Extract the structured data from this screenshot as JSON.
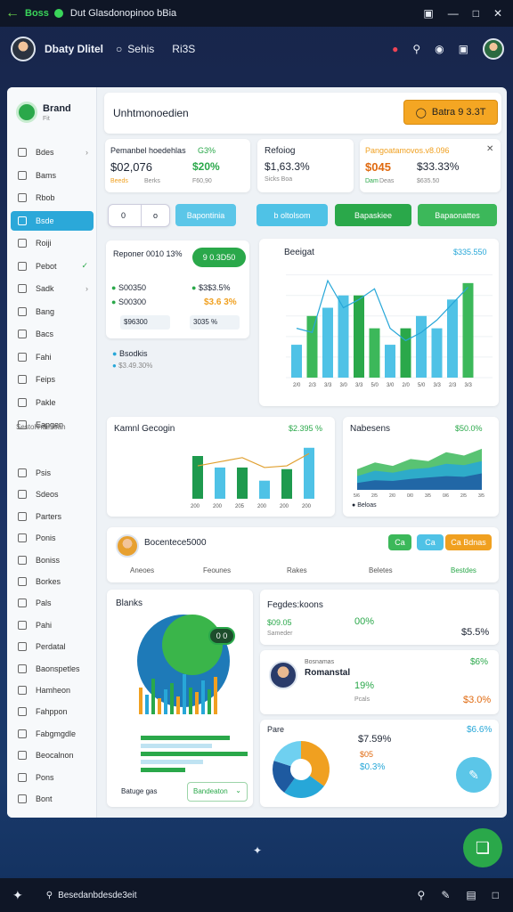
{
  "titlebar": {
    "app_name": "Boss",
    "title": "Dut Glasdonopinoo bBia"
  },
  "appbar": {
    "user_name": "Dbaty Dlitel",
    "nav": [
      "Sehis",
      "Ri3S"
    ]
  },
  "brand": {
    "name": "Brand",
    "sub": "Fit"
  },
  "header": {
    "title": "Unhtmonoedien",
    "cta": "Batra 9 3.3T"
  },
  "sidebar": {
    "items": [
      {
        "label": "Bdes"
      },
      {
        "label": "Bams"
      },
      {
        "label": "Rbob"
      },
      {
        "label": "Bsde"
      },
      {
        "label": "Roiji"
      },
      {
        "label": "Pebot"
      },
      {
        "label": "Sadk"
      },
      {
        "label": "Bang"
      },
      {
        "label": "Bacs"
      },
      {
        "label": "Fahi"
      },
      {
        "label": "Feips"
      },
      {
        "label": "Pakle"
      },
      {
        "label": "Eapgen"
      }
    ],
    "section_label": "Sestohhdesoan",
    "items2": [
      {
        "label": "Psis"
      },
      {
        "label": "Sdeos"
      },
      {
        "label": "Parters"
      },
      {
        "label": "Ponis"
      },
      {
        "label": "Boniss"
      },
      {
        "label": "Borkes"
      },
      {
        "label": "Pals"
      },
      {
        "label": "Pahi"
      },
      {
        "label": "Perdatal"
      },
      {
        "label": "Baonspetles"
      },
      {
        "label": "Hamheon"
      },
      {
        "label": "Fahppon"
      },
      {
        "label": "Fabgmgdle"
      },
      {
        "label": "Beocalnon"
      },
      {
        "label": "Pons"
      },
      {
        "label": "Bont"
      }
    ],
    "tag1": "Dar",
    "tag2": "Bcrsu"
  },
  "stats": [
    {
      "title": "Pemanbel hoedehlas",
      "pct": "G3%",
      "value": "$02,076",
      "delta": "$20%",
      "foot1": "Beeds",
      "foot2": "Berks",
      "foot3": "F60,90"
    },
    {
      "title": "Refoiog",
      "value": "$1,63.3%",
      "foot": "Sicks Boa"
    },
    {
      "title": "Pangoatamovos.v8.096",
      "value": "$045",
      "delta": "$33.33%",
      "foot1": "Dam",
      "foot2": "Deas",
      "foot3": "$635.50"
    }
  ],
  "filters": {
    "seg1": "0",
    "seg2": "o",
    "b1": "Bapontinia",
    "b2": "b oltolsom",
    "b3": "Bapaskiee",
    "b4": "Bapaonattes"
  },
  "mini": {
    "title": "Reponer 0010 13%",
    "badge": "9 0.3D50",
    "rows": [
      {
        "l": "S00350",
        "r": "$3$3.5%"
      },
      {
        "l": "S00300",
        "r": "$3.6 3%"
      },
      {
        "l": "$96300",
        "r": "3035 %"
      }
    ],
    "legend1": "Bsodkis",
    "legend2": "$3.49.30%"
  },
  "bar1": {
    "title": "Beeigat",
    "value": "$335.550"
  },
  "bar2": {
    "title": "Kamnl Gecogin",
    "value": "$2.395 %"
  },
  "area": {
    "title": "Nabesens",
    "value": "$50.0%",
    "legend": "Beloas"
  },
  "profile": {
    "title": "Bocentece5000",
    "cols": [
      "Aneoes",
      "Feounes",
      "Rakes",
      "Beletes",
      "Bestdes"
    ],
    "b1": "Ca",
    "b2": "Ca",
    "b3": "Ca Bdnas"
  },
  "donut": {
    "title": "Blanks",
    "badge": "0 0",
    "legend_title": "Batuge gas",
    "select": "Bandeaton"
  },
  "right": {
    "title": "Fegdes:koons",
    "r1a": "$09.05",
    "r1b": "00%",
    "r1c": "$5.5%",
    "r1d": "Sameder",
    "p_name": "Romanstal",
    "p_role": "Bosnamas",
    "p_pct": "$6%",
    "p_val": "19%",
    "p_small": "Pcals",
    "p_val2": "$3.0%",
    "d_title": "Pare",
    "d_pct": "$6.6%",
    "d_v1": "$7.59%",
    "d_v2": "$05",
    "d_v3": "$0.3%"
  },
  "taskbar": {
    "search": "Besedanbdesde3eit"
  },
  "chart_data": [
    {
      "type": "bar",
      "title": "Beeigat",
      "categories": [
        "2/0",
        "2/3",
        "3/3",
        "3/0",
        "3/3",
        "5/0",
        "3/0",
        "2/0",
        "5/0",
        "3/3",
        "2/3",
        "3/3"
      ],
      "series": [
        {
          "values": [
            40,
            75,
            85,
            100,
            100,
            60,
            40,
            60,
            75,
            60,
            95,
            115
          ]
        }
      ],
      "line": [
        60,
        55,
        118,
        85,
        95,
        108,
        60,
        45,
        55,
        70,
        90,
        110
      ]
    },
    {
      "type": "bar",
      "title": "Kamnl Gecogin",
      "categories": [
        "200",
        "200",
        "205",
        "200",
        "200",
        "200"
      ],
      "series": [
        {
          "values": [
            52,
            38,
            38,
            22,
            36,
            62
          ]
        }
      ],
      "line": [
        40,
        45,
        50,
        38,
        40,
        55
      ]
    },
    {
      "type": "area",
      "title": "Nabesens",
      "categories": [
        "5/6",
        "2/5",
        "2/0",
        "0/0",
        "3/5",
        "0/6",
        "2/5",
        "3/5"
      ],
      "series": [
        {
          "values": [
            30,
            40,
            35,
            45,
            42,
            55,
            50,
            60
          ]
        },
        {
          "values": [
            20,
            28,
            25,
            30,
            32,
            38,
            36,
            42
          ]
        },
        {
          "values": [
            10,
            14,
            13,
            16,
            18,
            20,
            19,
            24
          ]
        }
      ]
    },
    {
      "type": "pie",
      "title": "Pare",
      "values": [
        35,
        25,
        20,
        20
      ],
      "colors": [
        "#f0a020",
        "#27a7d8",
        "#1e5aa0",
        "#6fd0f0"
      ]
    }
  ],
  "colors": {
    "green": "#2aa84a",
    "orange": "#f0a020",
    "blue": "#27a7d8",
    "accent": "#f4a623"
  }
}
